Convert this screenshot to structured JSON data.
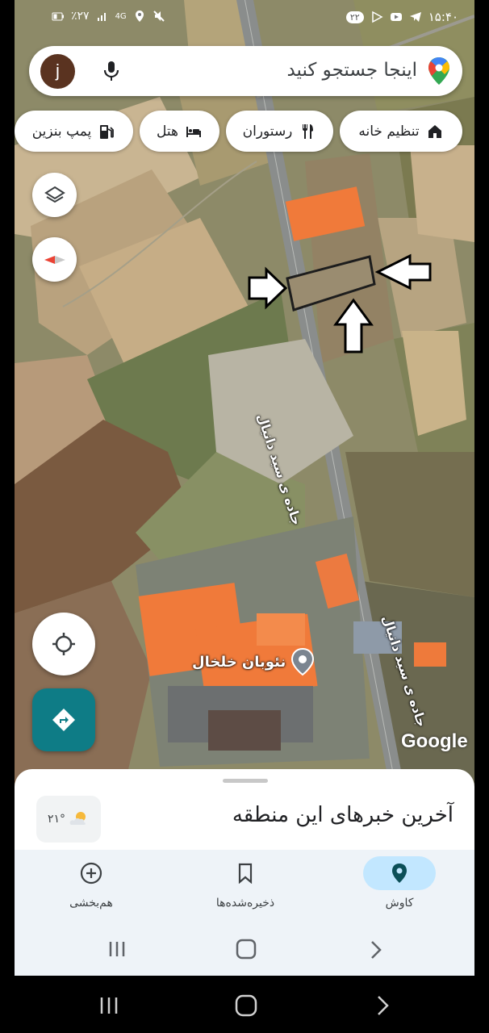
{
  "status_bar": {
    "time": "۱۵:۴۰",
    "battery": "٪۲۷",
    "network": "4G",
    "notification_count": "۲۲"
  },
  "search": {
    "placeholder": "اینجا جستجو کنید",
    "avatar_letter": "j"
  },
  "chips": [
    {
      "label": "تنظیم خانه",
      "icon": "home-icon"
    },
    {
      "label": "رستوران",
      "icon": "restaurant-icon"
    },
    {
      "label": "هتل",
      "icon": "hotel-icon"
    },
    {
      "label": "پمپ بنزین",
      "icon": "gas-station-icon"
    }
  ],
  "map": {
    "road_label_1": "جاده ی سید دانیال",
    "road_label_2": "جاده ی سید دانیال",
    "place_label": "نئوبان خلخال",
    "watermark": "Google"
  },
  "sheet": {
    "title": "آخرین خبرهای این منطقه",
    "weather": "۲۱°"
  },
  "nav": [
    {
      "label": "کاوش",
      "icon": "explore-pin-icon",
      "active": true
    },
    {
      "label": "ذخیره‌شده‌ها",
      "icon": "bookmark-icon",
      "active": false
    },
    {
      "label": "هم‌بخشی",
      "icon": "add-contribute-icon",
      "active": false
    }
  ],
  "colors": {
    "accent_teal": "#0e7c86",
    "active_pill": "#c2e7ff",
    "nav_bg": "#eef3f8",
    "roof_orange": "#f07a3a"
  }
}
